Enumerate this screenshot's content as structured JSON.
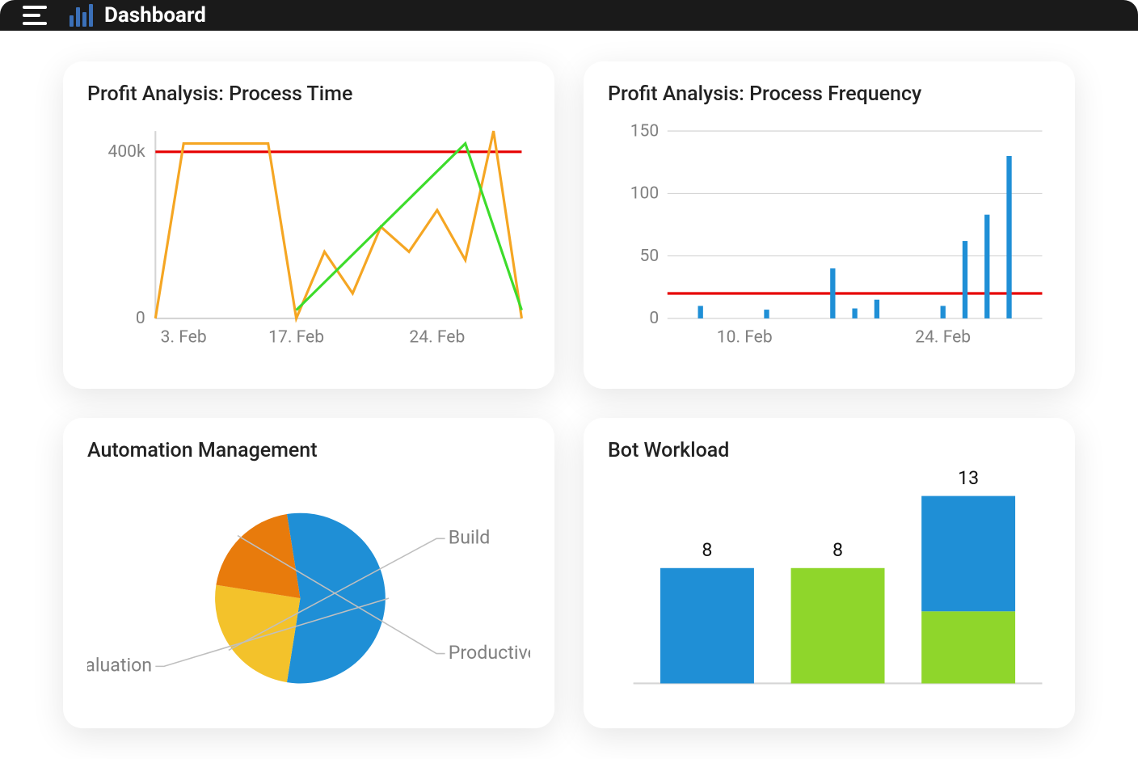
{
  "header": {
    "title": "Dashboard"
  },
  "cards": {
    "process_time": {
      "title": "Profit Analysis: Process Time"
    },
    "process_freq": {
      "title": "Profit Analysis: Process Frequency"
    },
    "automation": {
      "title": "Automation Management"
    },
    "workload": {
      "title": "Bot Workload"
    }
  },
  "chart_data": [
    {
      "id": "process_time",
      "type": "line",
      "title": "Profit Analysis: Process Time",
      "xlabel": "",
      "ylabel": "",
      "y_ticks": [
        "400k",
        "0"
      ],
      "x_ticks": [
        "3. Feb",
        "17. Feb",
        "24. Feb"
      ],
      "ylim": [
        0,
        450000
      ],
      "threshold": 400000,
      "threshold_color": "#e60000",
      "series": [
        {
          "name": "orange",
          "color": "#f5a623",
          "values": [
            0,
            420000,
            420000,
            420000,
            420000,
            0,
            160000,
            60000,
            220000,
            160000,
            260000,
            140000,
            450000,
            0
          ]
        },
        {
          "name": "green",
          "color": "#3ddc2b",
          "values": [
            null,
            null,
            null,
            null,
            null,
            20000,
            null,
            null,
            null,
            null,
            null,
            420000,
            null,
            20000
          ]
        }
      ]
    },
    {
      "id": "process_freq",
      "type": "bar",
      "title": "Profit Analysis: Process Frequency",
      "xlabel": "",
      "ylabel": "",
      "y_ticks": [
        "150",
        "100",
        "50",
        "0"
      ],
      "x_ticks": [
        "10. Feb",
        "24. Feb"
      ],
      "ylim": [
        0,
        150
      ],
      "threshold": 20,
      "threshold_color": "#e60000",
      "bar_color": "#1f8fd6",
      "points": [
        {
          "x_index": 1,
          "value": 10
        },
        {
          "x_index": 4,
          "value": 7
        },
        {
          "x_index": 7,
          "value": 40
        },
        {
          "x_index": 8,
          "value": 8
        },
        {
          "x_index": 9,
          "value": 15
        },
        {
          "x_index": 12,
          "value": 10
        },
        {
          "x_index": 13,
          "value": 62
        },
        {
          "x_index": 14,
          "value": 83
        },
        {
          "x_index": 15,
          "value": 130
        }
      ],
      "x_slots": 17
    },
    {
      "id": "automation",
      "type": "pie",
      "title": "Automation Management",
      "slices": [
        {
          "name": "Evaluation",
          "value": 55,
          "color": "#1f8fd6"
        },
        {
          "name": "Build",
          "value": 25,
          "color": "#f3c22b"
        },
        {
          "name": "Productive",
          "value": 20,
          "color": "#e87b0c"
        }
      ]
    },
    {
      "id": "workload",
      "type": "bar",
      "title": "Bot Workload",
      "stacked": true,
      "categories": [
        "",
        "",
        ""
      ],
      "data_labels": [
        8,
        8,
        13
      ],
      "series": [
        {
          "name": "blue",
          "color": "#1f8fd6",
          "values": [
            8,
            0,
            8
          ]
        },
        {
          "name": "green",
          "color": "#8fd62b",
          "values": [
            0,
            8,
            5
          ]
        }
      ],
      "ylim": [
        0,
        13
      ]
    }
  ]
}
